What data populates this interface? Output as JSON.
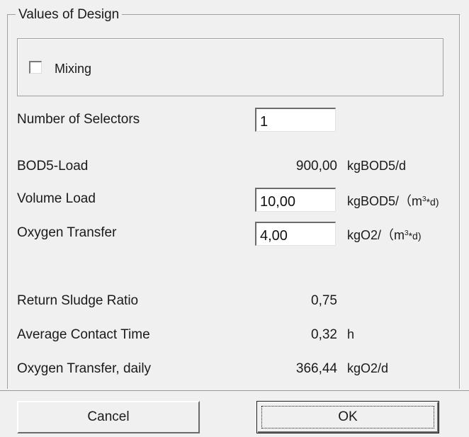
{
  "group_title": "Values of Design",
  "mixing": {
    "label": "Mixing",
    "checked": false
  },
  "rows": {
    "selectors": {
      "label": "Number of Selectors",
      "value": "1"
    },
    "bod5_load": {
      "label": "BOD5-Load",
      "value": "900,00",
      "unit": "kgBOD5/d"
    },
    "volume_load": {
      "label": "Volume Load",
      "value": "10,00",
      "unit_prefix": "kgBOD5/（m",
      "unit_sup": "3",
      "unit_suffix": "*d)"
    },
    "oxygen_transfer": {
      "label": "Oxygen Transfer",
      "value": "4,00",
      "unit_prefix": "kgO2/（m",
      "unit_sup": "3",
      "unit_suffix": "*d)"
    },
    "return_sludge": {
      "label": "Return Sludge Ratio",
      "value": "0,75"
    },
    "contact_time": {
      "label": "Average Contact Time",
      "value": "0,32",
      "unit": "h"
    },
    "oxygen_daily": {
      "label": "Oxygen Transfer, daily",
      "value": "366,44",
      "unit": "kgO2/d"
    }
  },
  "buttons": {
    "cancel": "Cancel",
    "ok": "OK"
  }
}
